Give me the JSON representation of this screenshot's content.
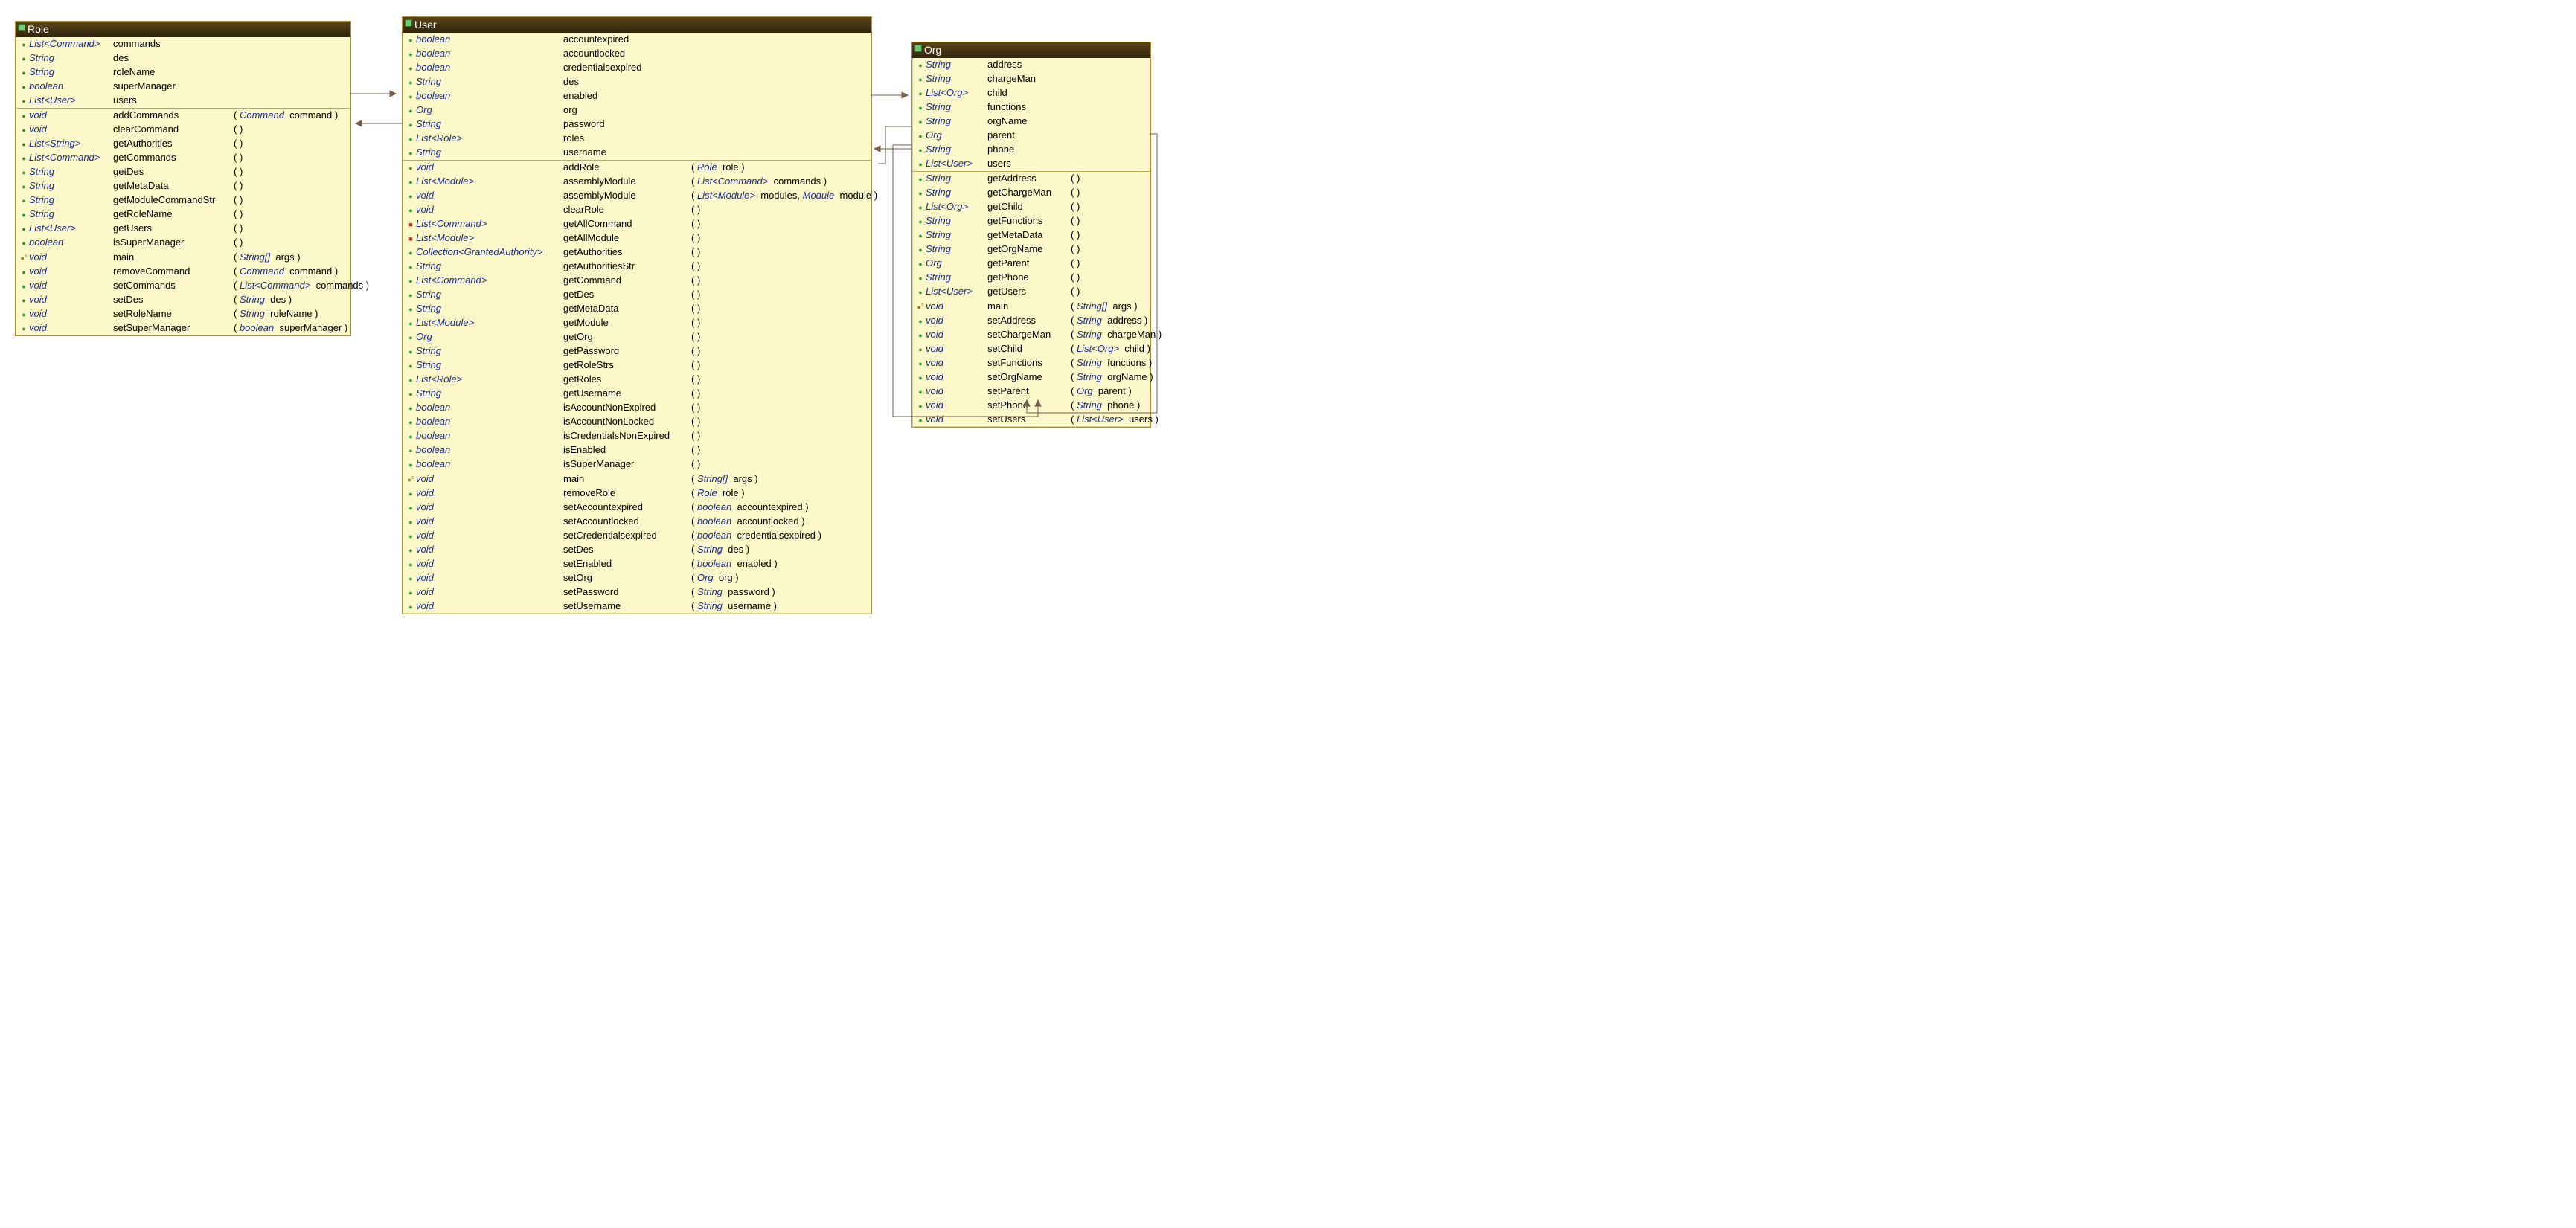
{
  "classes": {
    "role": {
      "title": "Role",
      "fields": [
        {
          "vis": "pub",
          "type": "List<Command>",
          "name": "commands"
        },
        {
          "vis": "pub",
          "type": "String",
          "name": "des"
        },
        {
          "vis": "pub",
          "type": "String",
          "name": "roleName"
        },
        {
          "vis": "pub",
          "type": "boolean",
          "name": "superManager"
        },
        {
          "vis": "pub",
          "type": "List<User>",
          "name": "users"
        }
      ],
      "methods": [
        {
          "vis": "pub",
          "ret": "void",
          "name": "addCommands",
          "args": [
            {
              "t": "Command",
              "n": "command"
            }
          ]
        },
        {
          "vis": "pub",
          "ret": "void",
          "name": "clearCommand",
          "args": []
        },
        {
          "vis": "pub",
          "ret": "List<String>",
          "name": "getAuthorities",
          "args": []
        },
        {
          "vis": "pub",
          "ret": "List<Command>",
          "name": "getCommands",
          "args": []
        },
        {
          "vis": "pub",
          "ret": "String",
          "name": "getDes",
          "args": []
        },
        {
          "vis": "pub",
          "ret": "String",
          "name": "getMetaData",
          "args": []
        },
        {
          "vis": "pub",
          "ret": "String",
          "name": "getModuleCommandStr",
          "args": []
        },
        {
          "vis": "pub",
          "ret": "String",
          "name": "getRoleName",
          "args": []
        },
        {
          "vis": "pub",
          "ret": "List<User>",
          "name": "getUsers",
          "args": []
        },
        {
          "vis": "pub",
          "ret": "boolean",
          "name": "isSuperManager",
          "args": []
        },
        {
          "vis": "stat",
          "ret": "void",
          "name": "main",
          "args": [
            {
              "t": "String[]",
              "n": "args"
            }
          ]
        },
        {
          "vis": "pub",
          "ret": "void",
          "name": "removeCommand",
          "args": [
            {
              "t": "Command",
              "n": "command"
            }
          ]
        },
        {
          "vis": "pub",
          "ret": "void",
          "name": "setCommands",
          "args": [
            {
              "t": "List<Command>",
              "n": "commands"
            }
          ]
        },
        {
          "vis": "pub",
          "ret": "void",
          "name": "setDes",
          "args": [
            {
              "t": "String",
              "n": "des"
            }
          ]
        },
        {
          "vis": "pub",
          "ret": "void",
          "name": "setRoleName",
          "args": [
            {
              "t": "String",
              "n": "roleName"
            }
          ]
        },
        {
          "vis": "pub",
          "ret": "void",
          "name": "setSuperManager",
          "args": [
            {
              "t": "boolean",
              "n": "superManager"
            }
          ]
        }
      ]
    },
    "user": {
      "title": "User",
      "fields": [
        {
          "vis": "pub",
          "type": "boolean",
          "name": "accountexpired"
        },
        {
          "vis": "pub",
          "type": "boolean",
          "name": "accountlocked"
        },
        {
          "vis": "pub",
          "type": "boolean",
          "name": "credentialsexpired"
        },
        {
          "vis": "pub",
          "type": "String",
          "name": "des"
        },
        {
          "vis": "pub",
          "type": "boolean",
          "name": "enabled"
        },
        {
          "vis": "pub",
          "type": "Org",
          "name": "org"
        },
        {
          "vis": "pub",
          "type": "String",
          "name": "password"
        },
        {
          "vis": "pub",
          "type": "List<Role>",
          "name": "roles"
        },
        {
          "vis": "pub",
          "type": "String",
          "name": "username"
        }
      ],
      "methods": [
        {
          "vis": "pub",
          "ret": "void",
          "name": "addRole",
          "args": [
            {
              "t": "Role",
              "n": "role"
            }
          ]
        },
        {
          "vis": "pub",
          "ret": "List<Module>",
          "name": "assemblyModule",
          "args": [
            {
              "t": "List<Command>",
              "n": "commands"
            }
          ]
        },
        {
          "vis": "pub",
          "ret": "void",
          "name": "assemblyModule",
          "args": [
            {
              "t": "List<Module>",
              "n": "modules"
            },
            {
              "t": "Module",
              "n": "module"
            }
          ]
        },
        {
          "vis": "pub",
          "ret": "void",
          "name": "clearRole",
          "args": []
        },
        {
          "vis": "pri",
          "ret": "List<Command>",
          "name": "getAllCommand",
          "args": []
        },
        {
          "vis": "pri",
          "ret": "List<Module>",
          "name": "getAllModule",
          "args": []
        },
        {
          "vis": "pub",
          "ret": "Collection<GrantedAuthority>",
          "name": "getAuthorities",
          "args": []
        },
        {
          "vis": "pub",
          "ret": "String",
          "name": "getAuthoritiesStr",
          "args": []
        },
        {
          "vis": "pub",
          "ret": "List<Command>",
          "name": "getCommand",
          "args": []
        },
        {
          "vis": "pub",
          "ret": "String",
          "name": "getDes",
          "args": []
        },
        {
          "vis": "pub",
          "ret": "String",
          "name": "getMetaData",
          "args": []
        },
        {
          "vis": "pub",
          "ret": "List<Module>",
          "name": "getModule",
          "args": []
        },
        {
          "vis": "pub",
          "ret": "Org",
          "name": "getOrg",
          "args": []
        },
        {
          "vis": "pub",
          "ret": "String",
          "name": "getPassword",
          "args": []
        },
        {
          "vis": "pub",
          "ret": "String",
          "name": "getRoleStrs",
          "args": []
        },
        {
          "vis": "pub",
          "ret": "List<Role>",
          "name": "getRoles",
          "args": []
        },
        {
          "vis": "pub",
          "ret": "String",
          "name": "getUsername",
          "args": []
        },
        {
          "vis": "pub",
          "ret": "boolean",
          "name": "isAccountNonExpired",
          "args": []
        },
        {
          "vis": "pub",
          "ret": "boolean",
          "name": "isAccountNonLocked",
          "args": []
        },
        {
          "vis": "pub",
          "ret": "boolean",
          "name": "isCredentialsNonExpired",
          "args": []
        },
        {
          "vis": "pub",
          "ret": "boolean",
          "name": "isEnabled",
          "args": []
        },
        {
          "vis": "pub",
          "ret": "boolean",
          "name": "isSuperManager",
          "args": []
        },
        {
          "vis": "stat",
          "ret": "void",
          "name": "main",
          "args": [
            {
              "t": "String[]",
              "n": "args"
            }
          ]
        },
        {
          "vis": "pub",
          "ret": "void",
          "name": "removeRole",
          "args": [
            {
              "t": "Role",
              "n": "role"
            }
          ]
        },
        {
          "vis": "pub",
          "ret": "void",
          "name": "setAccountexpired",
          "args": [
            {
              "t": "boolean",
              "n": "accountexpired"
            }
          ]
        },
        {
          "vis": "pub",
          "ret": "void",
          "name": "setAccountlocked",
          "args": [
            {
              "t": "boolean",
              "n": "accountlocked"
            }
          ]
        },
        {
          "vis": "pub",
          "ret": "void",
          "name": "setCredentialsexpired",
          "args": [
            {
              "t": "boolean",
              "n": "credentialsexpired"
            }
          ]
        },
        {
          "vis": "pub",
          "ret": "void",
          "name": "setDes",
          "args": [
            {
              "t": "String",
              "n": "des"
            }
          ]
        },
        {
          "vis": "pub",
          "ret": "void",
          "name": "setEnabled",
          "args": [
            {
              "t": "boolean",
              "n": "enabled"
            }
          ]
        },
        {
          "vis": "pub",
          "ret": "void",
          "name": "setOrg",
          "args": [
            {
              "t": "Org",
              "n": "org"
            }
          ]
        },
        {
          "vis": "pub",
          "ret": "void",
          "name": "setPassword",
          "args": [
            {
              "t": "String",
              "n": "password"
            }
          ]
        },
        {
          "vis": "pub",
          "ret": "void",
          "name": "setUsername",
          "args": [
            {
              "t": "String",
              "n": "username"
            }
          ]
        }
      ]
    },
    "org": {
      "title": "Org",
      "fields": [
        {
          "vis": "pub",
          "type": "String",
          "name": "address"
        },
        {
          "vis": "pub",
          "type": "String",
          "name": "chargeMan"
        },
        {
          "vis": "pub",
          "type": "List<Org>",
          "name": "child"
        },
        {
          "vis": "pub",
          "type": "String",
          "name": "functions"
        },
        {
          "vis": "pub",
          "type": "String",
          "name": "orgName"
        },
        {
          "vis": "pub",
          "type": "Org",
          "name": "parent"
        },
        {
          "vis": "pub",
          "type": "String",
          "name": "phone"
        },
        {
          "vis": "pub",
          "type": "List<User>",
          "name": "users"
        }
      ],
      "methods": [
        {
          "vis": "pub",
          "ret": "String",
          "name": "getAddress",
          "args": []
        },
        {
          "vis": "pub",
          "ret": "String",
          "name": "getChargeMan",
          "args": []
        },
        {
          "vis": "pub",
          "ret": "List<Org>",
          "name": "getChild",
          "args": []
        },
        {
          "vis": "pub",
          "ret": "String",
          "name": "getFunctions",
          "args": []
        },
        {
          "vis": "pub",
          "ret": "String",
          "name": "getMetaData",
          "args": []
        },
        {
          "vis": "pub",
          "ret": "String",
          "name": "getOrgName",
          "args": []
        },
        {
          "vis": "pub",
          "ret": "Org",
          "name": "getParent",
          "args": []
        },
        {
          "vis": "pub",
          "ret": "String",
          "name": "getPhone",
          "args": []
        },
        {
          "vis": "pub",
          "ret": "List<User>",
          "name": "getUsers",
          "args": []
        },
        {
          "vis": "stat",
          "ret": "void",
          "name": "main",
          "args": [
            {
              "t": "String[]",
              "n": "args"
            }
          ]
        },
        {
          "vis": "pub",
          "ret": "void",
          "name": "setAddress",
          "args": [
            {
              "t": "String",
              "n": "address"
            }
          ]
        },
        {
          "vis": "pub",
          "ret": "void",
          "name": "setChargeMan",
          "args": [
            {
              "t": "String",
              "n": "chargeMan"
            }
          ]
        },
        {
          "vis": "pub",
          "ret": "void",
          "name": "setChild",
          "args": [
            {
              "t": "List<Org>",
              "n": "child"
            }
          ]
        },
        {
          "vis": "pub",
          "ret": "void",
          "name": "setFunctions",
          "args": [
            {
              "t": "String",
              "n": "functions"
            }
          ]
        },
        {
          "vis": "pub",
          "ret": "void",
          "name": "setOrgName",
          "args": [
            {
              "t": "String",
              "n": "orgName"
            }
          ]
        },
        {
          "vis": "pub",
          "ret": "void",
          "name": "setParent",
          "args": [
            {
              "t": "Org",
              "n": "parent"
            }
          ]
        },
        {
          "vis": "pub",
          "ret": "void",
          "name": "setPhone",
          "args": [
            {
              "t": "String",
              "n": "phone"
            }
          ]
        },
        {
          "vis": "pub",
          "ret": "void",
          "name": "setUsers",
          "args": [
            {
              "t": "List<User>",
              "n": "users"
            }
          ]
        }
      ]
    }
  }
}
